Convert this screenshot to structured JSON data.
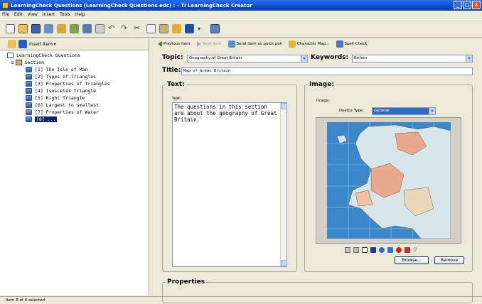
{
  "window": {
    "title": "LearningCheck Questions (LearningCheck Questions.edc) : - TI LearningCheck Creator",
    "controls": {
      "minimize": "_",
      "maximize": "□",
      "close": "×"
    }
  },
  "menu": {
    "items": [
      "File",
      "Edit",
      "View",
      "Insert",
      "Tools",
      "Help"
    ]
  },
  "left": {
    "insert_item_label": "Insert Item ▾",
    "tree": {
      "root": "LearningCheck Questions",
      "section": "Section",
      "items": [
        "[1] The Isle of Man",
        "[2] Types of Triangles",
        "[3] Properties of Triangles",
        "[4] Isosceles Triangle",
        "[5] Right Triangle",
        "[6] Largest to smallest",
        "[7] Properties of Water"
      ],
      "selected_item": "[8] ..."
    }
  },
  "nav": {
    "previous": "Previous Item",
    "next": "Next Item",
    "send_quick_poll": "Send item as quick poll",
    "character_map": "Character Map...",
    "spell_check": "Spell Check"
  },
  "form": {
    "topic_label": "Topic:",
    "topic_value": "Geography of Great Britain",
    "keywords_label": "Keywords:",
    "keywords_value": "Britain",
    "title_label": "Title:",
    "title_value": "Map of Great Britain",
    "text_group": "Text:",
    "text_sublabel": "Text:",
    "text_body": "The questions in this section are about the geography of Great Britain.",
    "image_group": "Image:",
    "image_sublabel": "Image:",
    "device_type_label": "Device Type:",
    "device_type_value": "General",
    "browse_label": "Browse...",
    "remove_label": "Remove",
    "properties_group": "Properties"
  },
  "status": {
    "text": "Item 8 of 8 selected"
  },
  "colors": {
    "sea": "#3a87c9",
    "land_a": "#e8a98c",
    "land_b": "#d7e6ea",
    "selection": "#0a246a"
  }
}
